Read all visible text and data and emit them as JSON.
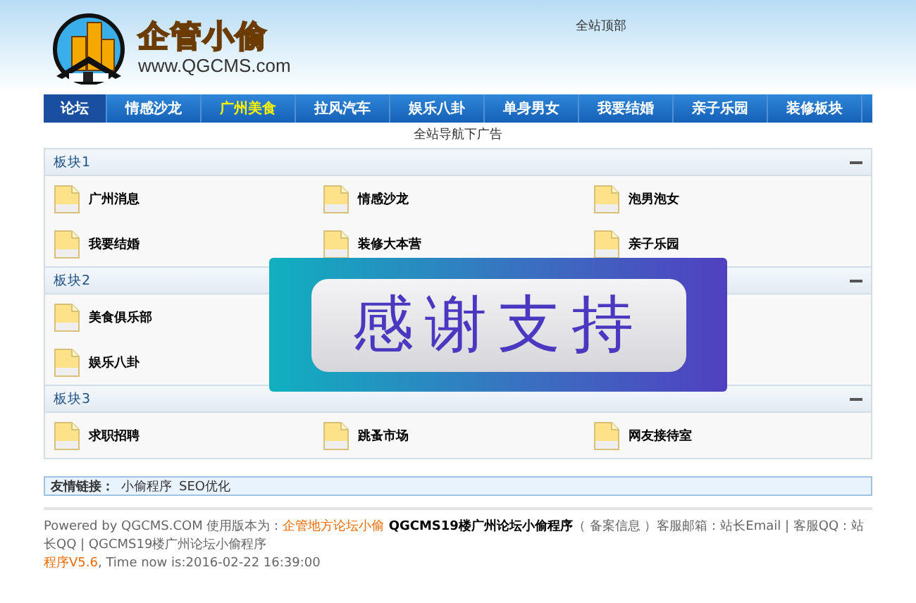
{
  "header": {
    "logo_title": "企管小偷",
    "logo_url": "www.QGCMS.com",
    "top_ad": "全站顶部"
  },
  "nav": [
    {
      "label": "论坛",
      "selected": true,
      "highlighted": false
    },
    {
      "label": "情感沙龙",
      "selected": false,
      "highlighted": false
    },
    {
      "label": "广州美食",
      "selected": false,
      "highlighted": true
    },
    {
      "label": "拉风汽车",
      "selected": false,
      "highlighted": false
    },
    {
      "label": "娱乐八卦",
      "selected": false,
      "highlighted": false
    },
    {
      "label": "单身男女",
      "selected": false,
      "highlighted": false
    },
    {
      "label": "我要结婚",
      "selected": false,
      "highlighted": false
    },
    {
      "label": "亲子乐园",
      "selected": false,
      "highlighted": false
    },
    {
      "label": "装修板块",
      "selected": false,
      "highlighted": false
    }
  ],
  "nav_ad": "全站导航下广告",
  "sections": [
    {
      "title": "板块1",
      "expanded": true,
      "rows": [
        [
          "广州消息",
          "情感沙龙",
          "泡男泡女"
        ],
        [
          "我要结婚",
          "装修大本营",
          "亲子乐园"
        ]
      ]
    },
    {
      "title": "板块2",
      "expanded": true,
      "rows": [
        [
          "美食俱乐部"
        ],
        [
          "娱乐八卦"
        ]
      ]
    },
    {
      "title": "板块3",
      "expanded": true,
      "rows": [
        [
          "求职招聘",
          "跳蚤市场",
          "网友接待室"
        ]
      ]
    }
  ],
  "popup": {
    "text": "感谢支持"
  },
  "friend_links": {
    "label": "友情链接：",
    "links": [
      "小偷程序",
      "SEO优化"
    ]
  },
  "footer": [
    [
      {
        "kind": "plain",
        "text": "Powered by QGCMS.COM 使用版本为："
      },
      {
        "kind": "link",
        "text": "企管地方论坛小偷"
      },
      {
        "kind": "bold",
        "text": " QGCMS19楼广州论坛小偷程序"
      },
      {
        "kind": "plain",
        "text": "（ 备案信息 ）客服邮箱：站长Email | 客服QQ：站长QQ | QGCMS19楼广州论坛小偷程序"
      }
    ],
    [
      {
        "kind": "link",
        "text": "程序V5.6"
      },
      {
        "kind": "plain",
        "text": ", Time now is:2016-02-22 16:39:00"
      }
    ]
  ]
}
